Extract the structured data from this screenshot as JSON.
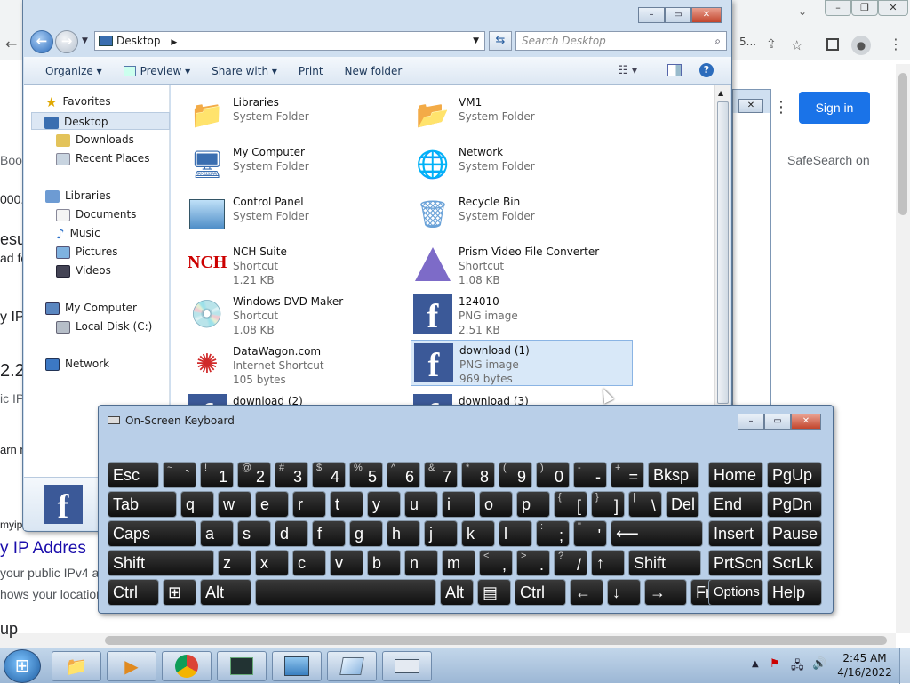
{
  "chrome": {
    "sign_in": "Sign in",
    "safesearch": "SafeSearch on",
    "left_fragments": [
      "Book",
      "000,",
      "esu",
      "ad fo",
      "y IP",
      "2.2.",
      "ic IP",
      "arn m",
      "myip",
      "y IP Addres",
      "your public IPv4 a",
      "hows your location",
      "up"
    ],
    "tab_partial": "5..."
  },
  "explorer": {
    "address": "Desktop",
    "search_placeholder": "Search Desktop",
    "toolbar": [
      "Organize ▾",
      "Preview ▾",
      "Share with ▾",
      "Print",
      "New folder"
    ],
    "nav": {
      "favorites": "Favorites",
      "desktop": "Desktop",
      "downloads": "Downloads",
      "recent": "Recent Places",
      "libraries": "Libraries",
      "documents": "Documents",
      "music": "Music",
      "pictures": "Pictures",
      "videos": "Videos",
      "computer": "My Computer",
      "localdisk": "Local Disk (C:)",
      "network": "Network"
    },
    "items": [
      {
        "name": "Libraries",
        "type": "System Folder",
        "size": ""
      },
      {
        "name": "VM1",
        "type": "System Folder",
        "size": ""
      },
      {
        "name": "My Computer",
        "type": "System Folder",
        "size": ""
      },
      {
        "name": "Network",
        "type": "System Folder",
        "size": ""
      },
      {
        "name": "Control Panel",
        "type": "System Folder",
        "size": ""
      },
      {
        "name": "Recycle Bin",
        "type": "System Folder",
        "size": ""
      },
      {
        "name": "NCH Suite",
        "type": "Shortcut",
        "size": "1.21 KB"
      },
      {
        "name": "Prism Video File Converter",
        "type": "Shortcut",
        "size": "1.08 KB"
      },
      {
        "name": "Windows DVD Maker",
        "type": "Shortcut",
        "size": "1.08 KB"
      },
      {
        "name": "124010",
        "type": "PNG image",
        "size": "2.51 KB"
      },
      {
        "name": "DataWagon.com",
        "type": "Internet Shortcut",
        "size": "105 bytes"
      },
      {
        "name": "download (1)",
        "type": "PNG image",
        "size": "969 bytes"
      },
      {
        "name": "download (2)",
        "type": "",
        "size": ""
      },
      {
        "name": "download (3)",
        "type": "",
        "size": ""
      }
    ]
  },
  "osk": {
    "title": "On-Screen Keyboard",
    "rows": [
      [
        [
          "Esc",
          ""
        ],
        [
          "~",
          "`"
        ],
        [
          "!",
          "1"
        ],
        [
          "@",
          "2"
        ],
        [
          "#",
          "3"
        ],
        [
          "$",
          "4"
        ],
        [
          "%",
          "5"
        ],
        [
          "^",
          "6"
        ],
        [
          "&",
          "7"
        ],
        [
          "*",
          "8"
        ],
        [
          "(",
          "9"
        ],
        [
          ")",
          "0"
        ],
        [
          "-",
          "-"
        ],
        [
          "+",
          "="
        ],
        [
          "Bksp",
          ""
        ],
        [
          "Home",
          ""
        ],
        [
          "PgUp",
          ""
        ]
      ],
      [
        [
          "Tab",
          ""
        ],
        [
          "q",
          ""
        ],
        [
          "w",
          ""
        ],
        [
          "e",
          ""
        ],
        [
          "r",
          ""
        ],
        [
          "t",
          ""
        ],
        [
          "y",
          ""
        ],
        [
          "u",
          ""
        ],
        [
          "i",
          ""
        ],
        [
          "o",
          ""
        ],
        [
          "p",
          ""
        ],
        [
          "{",
          "["
        ],
        [
          "}",
          "]"
        ],
        [
          "|",
          "\\"
        ],
        [
          "Del",
          ""
        ],
        [
          "End",
          ""
        ],
        [
          "PgDn",
          ""
        ]
      ],
      [
        [
          "Caps",
          ""
        ],
        [
          "a",
          ""
        ],
        [
          "s",
          ""
        ],
        [
          "d",
          ""
        ],
        [
          "f",
          ""
        ],
        [
          "g",
          ""
        ],
        [
          "h",
          ""
        ],
        [
          "j",
          ""
        ],
        [
          "k",
          ""
        ],
        [
          "l",
          ""
        ],
        [
          ":",
          ";"
        ],
        [
          "\"",
          "'"
        ],
        [
          "⟵",
          ""
        ],
        [
          "Insert",
          ""
        ],
        [
          "Pause",
          ""
        ]
      ],
      [
        [
          "Shift",
          ""
        ],
        [
          "z",
          ""
        ],
        [
          "x",
          ""
        ],
        [
          "c",
          ""
        ],
        [
          "v",
          ""
        ],
        [
          "b",
          ""
        ],
        [
          "n",
          ""
        ],
        [
          "m",
          ""
        ],
        [
          "<",
          ","
        ],
        [
          ">",
          "."
        ],
        [
          "?",
          "/"
        ],
        [
          "↑",
          ""
        ],
        [
          "Shift",
          ""
        ],
        [
          "PrtScn",
          ""
        ],
        [
          "ScrLk",
          ""
        ]
      ],
      [
        [
          "Ctrl",
          ""
        ],
        [
          "⊞",
          ""
        ],
        [
          "Alt",
          ""
        ],
        [
          "",
          ""
        ],
        [
          "Alt",
          ""
        ],
        [
          "▤",
          ""
        ],
        [
          "Ctrl",
          ""
        ],
        [
          "←",
          ""
        ],
        [
          "↓",
          ""
        ],
        [
          "→",
          ""
        ],
        [
          "Fn",
          ""
        ],
        [
          "Options",
          ""
        ],
        [
          "Help",
          ""
        ]
      ]
    ]
  },
  "taskbar": {
    "time": "2:45 AM",
    "date": "4/16/2022"
  }
}
